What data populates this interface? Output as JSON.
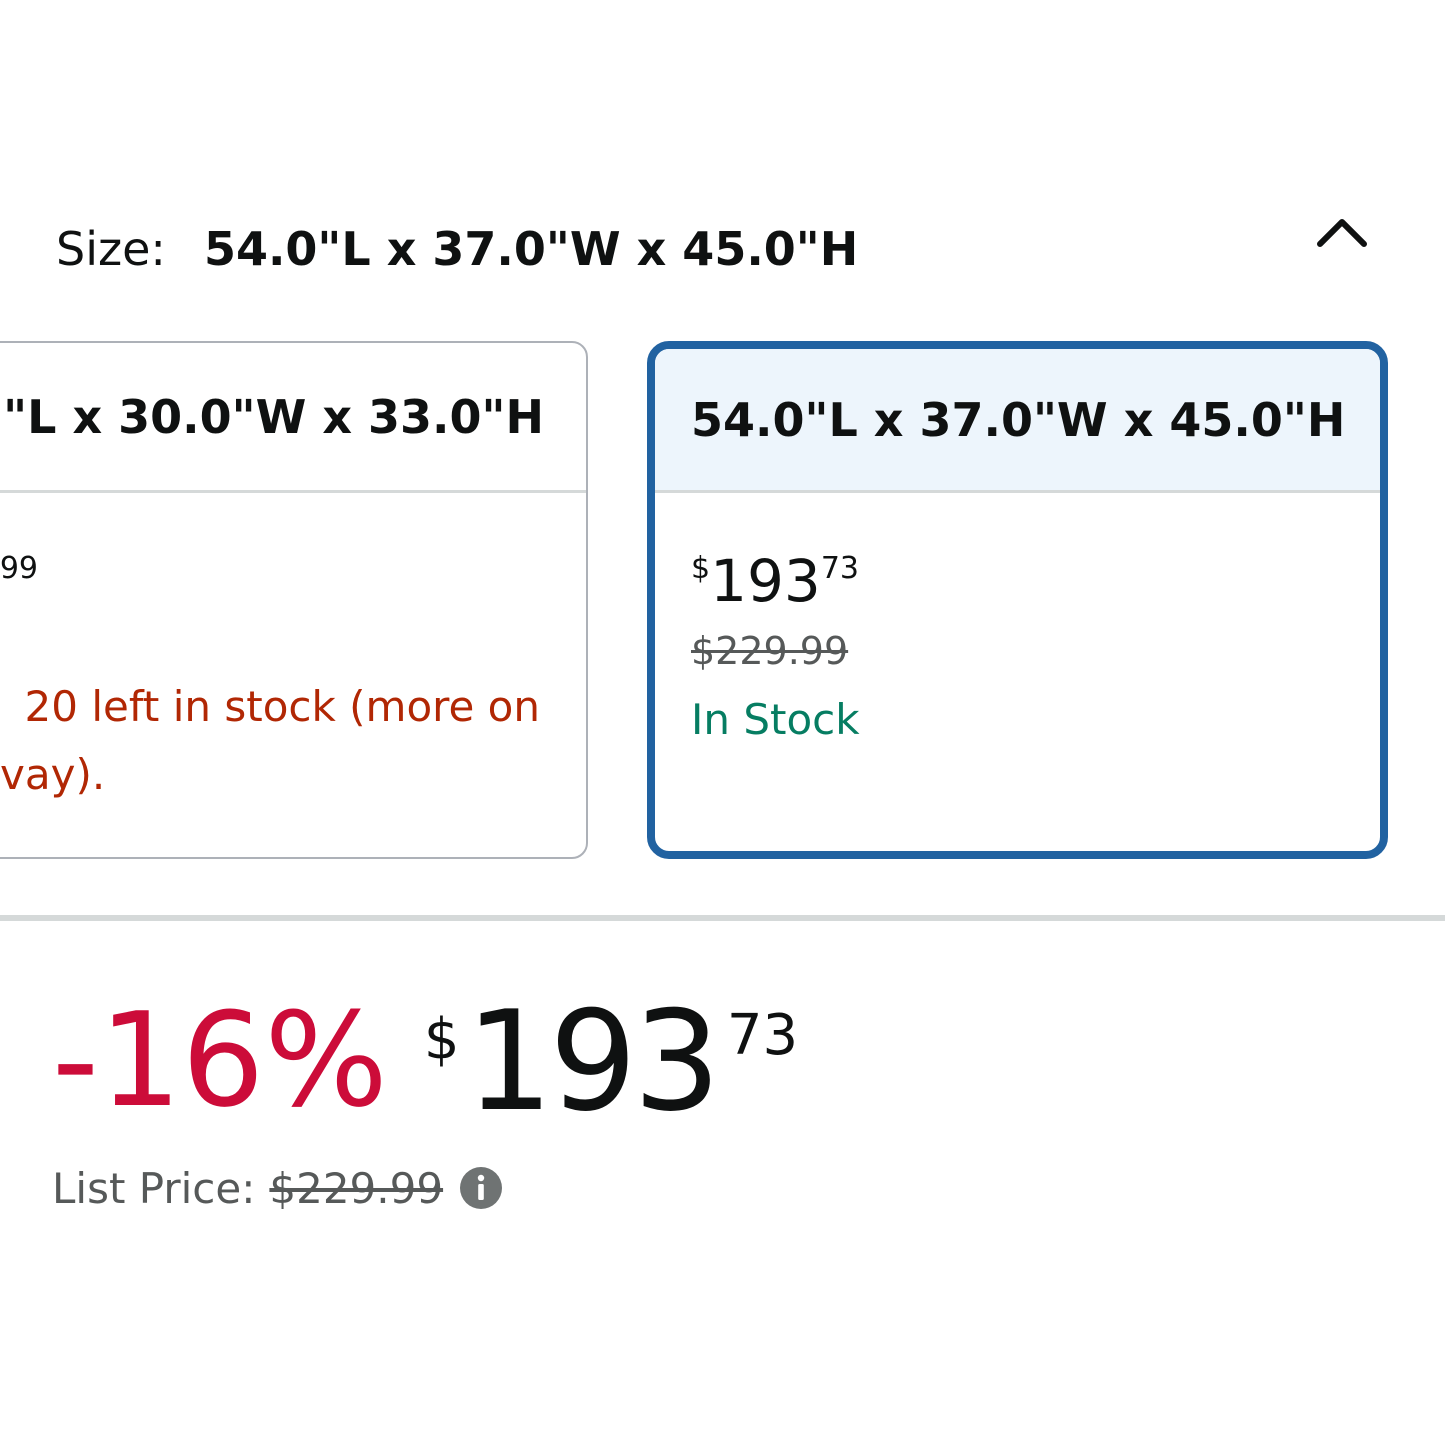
{
  "size": {
    "label": "Size:",
    "value": "54.0\"L x 37.0\"W x 45.0\"H",
    "collapse_icon": "chevron-up-icon"
  },
  "options": [
    {
      "title": "\"L x 30.0\"W x 33.0\"H",
      "price_fragment": "99",
      "stock_line1": "20 left in stock (more on",
      "stock_line2": "vay).",
      "selected": false
    },
    {
      "title": "54.0\"L x 37.0\"W x 45.0\"H",
      "price_symbol": "$",
      "price_whole": "193",
      "price_fraction": "73",
      "list_price": "$229.99",
      "stock": "In Stock",
      "selected": true
    }
  ],
  "price": {
    "discount": "-16%",
    "symbol": "$",
    "whole": "193",
    "fraction": "73",
    "list_price_label": "List Price:",
    "list_price_value": "$229.99",
    "info_icon": "info-icon"
  },
  "colors": {
    "selected_border": "#2162a1",
    "selected_header_bg": "#edf5fc",
    "discount": "#cc0c39",
    "in_stock": "#067d62",
    "low_stock": "#b12704"
  }
}
